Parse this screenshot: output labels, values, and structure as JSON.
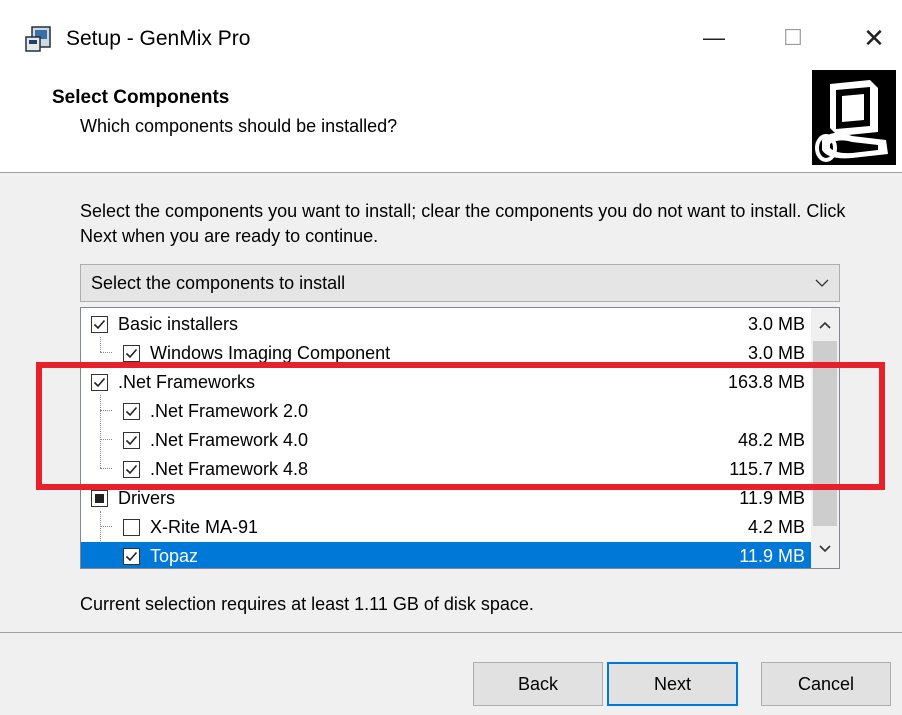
{
  "window": {
    "title": "Setup - GenMix Pro",
    "minimize_glyph": "—",
    "maximize_glyph": "☐",
    "close_glyph": "✕"
  },
  "header": {
    "title": "Select Components",
    "subtitle": "Which components should be installed?",
    "image_icon": "computer-install-icon"
  },
  "intro_text": "Select the components you want to install; clear the components you do not want to install. Click Next when you are ready to continue.",
  "type_select": {
    "value": "Select the components to install"
  },
  "components": [
    {
      "label": "Basic installers",
      "size": "3.0 MB",
      "level": 0,
      "state": "checked",
      "selected": false
    },
    {
      "label": "Windows Imaging Component",
      "size": "3.0 MB",
      "level": 1,
      "state": "checked",
      "selected": false
    },
    {
      "label": ".Net Frameworks",
      "size": "163.8 MB",
      "level": 0,
      "state": "checked",
      "selected": false
    },
    {
      "label": ".Net Framework 2.0",
      "size": "",
      "level": 1,
      "state": "checked",
      "selected": false
    },
    {
      "label": ".Net Framework 4.0",
      "size": "48.2 MB",
      "level": 1,
      "state": "checked",
      "selected": false
    },
    {
      "label": ".Net Framework 4.8",
      "size": "115.7 MB",
      "level": 1,
      "state": "checked",
      "selected": false
    },
    {
      "label": "Drivers",
      "size": "11.9 MB",
      "level": 0,
      "state": "partial",
      "selected": false
    },
    {
      "label": "X-Rite MA-91",
      "size": "4.2 MB",
      "level": 1,
      "state": "unchecked",
      "selected": false
    },
    {
      "label": "Topaz",
      "size": "11.9 MB",
      "level": 1,
      "state": "checked",
      "selected": true
    }
  ],
  "disk_space_text": "Current selection requires at least 1.11 GB of disk space.",
  "buttons": {
    "back": "Back",
    "next": "Next",
    "cancel": "Cancel"
  },
  "colors": {
    "highlight_box": "#e8202a",
    "selection": "#0078d7"
  }
}
